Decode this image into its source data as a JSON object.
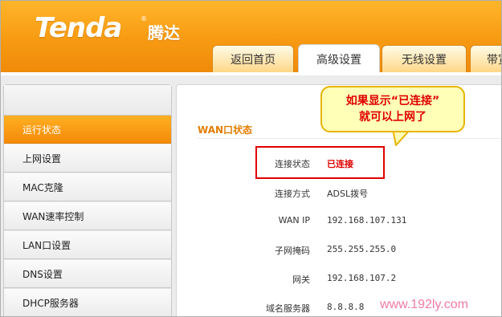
{
  "brand": {
    "logo_text": "Tenda",
    "logo_reg": "®",
    "logo_cn": "腾达"
  },
  "tabs": [
    {
      "label": "返回首页",
      "active": false
    },
    {
      "label": "高级设置",
      "active": true
    },
    {
      "label": "无线设置",
      "active": false
    },
    {
      "label": "带宽",
      "active": false
    }
  ],
  "sidebar": {
    "items": [
      {
        "label": "运行状态",
        "active": true
      },
      {
        "label": "上网设置",
        "active": false
      },
      {
        "label": "MAC克隆",
        "active": false
      },
      {
        "label": "WAN速率控制",
        "active": false
      },
      {
        "label": "LAN口设置",
        "active": false
      },
      {
        "label": "DNS设置",
        "active": false
      },
      {
        "label": "DHCP服务器",
        "active": false
      }
    ]
  },
  "main": {
    "section_title": "WAN口状态",
    "rows": [
      {
        "label": "连接状态",
        "value": "已连接"
      },
      {
        "label": "连接方式",
        "value": "ADSL拨号"
      },
      {
        "label": "WAN IP",
        "value": "192.168.107.131"
      },
      {
        "label": "子网掩码",
        "value": "255.255.255.0"
      },
      {
        "label": "网关",
        "value": "192.168.107.2"
      },
      {
        "label": "域名服务器",
        "value": "8.8.8.8"
      }
    ]
  },
  "callout": {
    "line1": "如果显示“已连接”",
    "line2": "就可以上网了"
  },
  "watermark": "www.192ly.com",
  "colors": {
    "accent_orange": "#f79a12",
    "highlight_red": "#e00000",
    "callout_bg": "#ffffb8",
    "watermark": "#f07aa6"
  }
}
